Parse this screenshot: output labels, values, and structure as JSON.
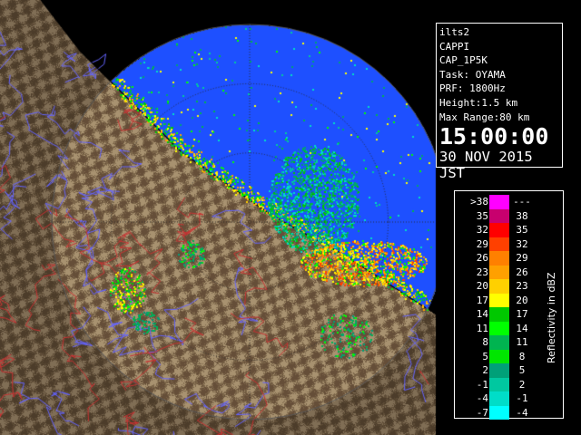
{
  "info": {
    "product": "ilts2",
    "type": "CAPPI",
    "scan": "CAP_1P5K",
    "task": "Task: OYAMA",
    "prf": "PRF: 1800Hz",
    "height": "Height:1.5 km",
    "max_range": "Max Range:80 km",
    "time": "15:00:00",
    "date": "30 NOV 2015 JST"
  },
  "legend": {
    "title": "Reflectivity in dBZ",
    "rows": [
      {
        "lo": ">38",
        "hi": "---",
        "color": "#ff00ff"
      },
      {
        "lo": "35",
        "hi": "38",
        "color": "#c8006e"
      },
      {
        "lo": "32",
        "hi": "35",
        "color": "#ff0000"
      },
      {
        "lo": "29",
        "hi": "32",
        "color": "#ff4000"
      },
      {
        "lo": "26",
        "hi": "29",
        "color": "#ff8000"
      },
      {
        "lo": "23",
        "hi": "26",
        "color": "#ffa000"
      },
      {
        "lo": "20",
        "hi": "23",
        "color": "#ffd000"
      },
      {
        "lo": "17",
        "hi": "20",
        "color": "#ffff00"
      },
      {
        "lo": "14",
        "hi": "17",
        "color": "#00c800"
      },
      {
        "lo": "11",
        "hi": "14",
        "color": "#00ff00"
      },
      {
        "lo": "8",
        "hi": "11",
        "color": "#00b450"
      },
      {
        "lo": "5",
        "hi": "8",
        "color": "#00e600"
      },
      {
        "lo": "2",
        "hi": "5",
        "color": "#00a078"
      },
      {
        "lo": "-1",
        "hi": "2",
        "color": "#00c8a0"
      },
      {
        "lo": "-4",
        "hi": "-1",
        "color": "#00ddc8"
      },
      {
        "lo": "-7",
        "hi": "-4",
        "color": "#00ffff"
      }
    ]
  },
  "colors": {
    "background": "#000000",
    "sea_echo_free": "#1e50ff",
    "land_dark": "#5a4632",
    "land_light": "#a08c6e",
    "rivers": "#6464ff",
    "boundaries": "#c83232"
  }
}
